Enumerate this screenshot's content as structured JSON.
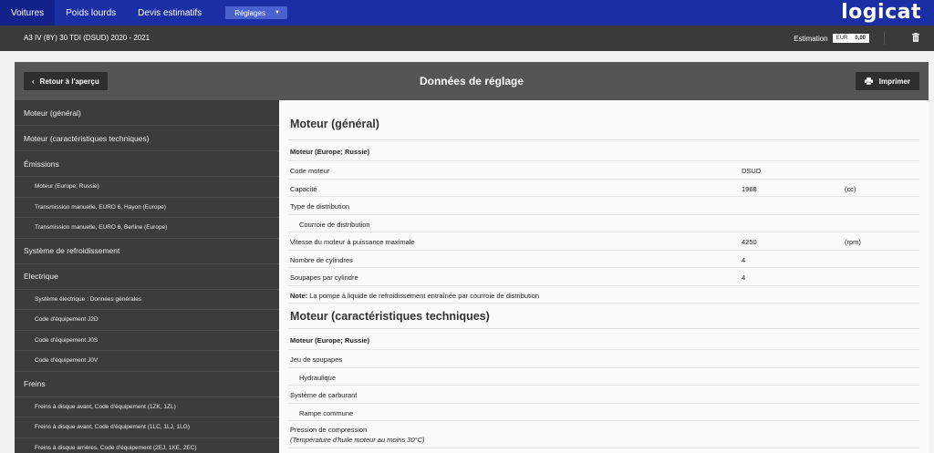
{
  "nav": {
    "tabs": [
      {
        "label": "Voitures"
      },
      {
        "label": "Poids lourds"
      },
      {
        "label": "Devis estimatifs"
      }
    ],
    "dropdown_label": "Réglages",
    "logo": "logicat"
  },
  "vehicle": {
    "name": "A3 IV (8Y) 30 TDI (DSUD) 2020 - 2021",
    "estimation_label": "Estimation",
    "currency": "EUR",
    "amount": "0,00"
  },
  "panel": {
    "back_label": "Retour à l'aperçu",
    "title": "Données de réglage",
    "print_label": "Imprimer"
  },
  "sidebar": {
    "items": [
      {
        "label": "Moteur (général)",
        "level": 1
      },
      {
        "label": "Moteur (caractéristiques techniques)",
        "level": 1
      },
      {
        "label": "Émissions",
        "level": 1
      },
      {
        "label": "Moteur (Europe; Russie)",
        "level": 2
      },
      {
        "label": "Transmission manuelle, EURO 6, Hayon (Europe)",
        "level": 2
      },
      {
        "label": "Transmission manuelle, EURO 6, Berline (Europe)",
        "level": 2
      },
      {
        "label": "Système de refroidissement",
        "level": 1
      },
      {
        "label": "Electrique",
        "level": 1
      },
      {
        "label": "Système électrique : Données générales",
        "level": 2
      },
      {
        "label": "Code d'équipement J2D",
        "level": 2
      },
      {
        "label": "Code d'équipement J0S",
        "level": 2
      },
      {
        "label": "Code d'équipement J0V",
        "level": 2
      },
      {
        "label": "Freins",
        "level": 1
      },
      {
        "label": "Freins à disque avant, Code d'équipement (1ZK, 1ZL)",
        "level": 2
      },
      {
        "label": "Freins à disque avant, Code d'équipement (1LC, 1LJ, 1LG)",
        "level": 2
      },
      {
        "label": "Freins à disque arrières, Code d'équipement (2EJ, 1KE, 2EC)",
        "level": 2
      }
    ]
  },
  "content": {
    "sections": [
      {
        "title": "Moteur (général)",
        "subtitle": "Moteur (Europe; Russie)",
        "rows": [
          {
            "label": "Code moteur",
            "value": "DSUD",
            "unit": ""
          },
          {
            "label": "Capacité",
            "value": "1968",
            "unit": "(cc)"
          },
          {
            "label": "Type de distribution",
            "value": "",
            "unit": ""
          },
          {
            "label": "Courroie de distribution",
            "value": "",
            "unit": "",
            "indent": true
          },
          {
            "label": "Vitesse du moteur à puissance maximale",
            "value": "4250",
            "unit": "(rpm)"
          },
          {
            "label": "Nombre de cylindres",
            "value": "4",
            "unit": ""
          },
          {
            "label": "Soupapes par cylindre",
            "value": "4",
            "unit": ""
          }
        ],
        "note_label": "Note:",
        "note_text": "La pompe à liquide de refroidissement entraînée par courroie de distribution"
      },
      {
        "title": "Moteur (caractéristiques techniques)",
        "subtitle": "Moteur (Europe; Russie)",
        "rows": [
          {
            "label": "Jeu de soupapes",
            "value": "",
            "unit": ""
          },
          {
            "label": "Hydraulique",
            "value": "",
            "unit": "",
            "indent": true
          },
          {
            "label": "Système de carburant",
            "value": "",
            "unit": ""
          },
          {
            "label": "Rampe commune",
            "value": "",
            "unit": "",
            "indent": true
          }
        ],
        "last_label": "Pression de compression",
        "last_sub": "(Température d'huile moteur au moins 30°C)"
      }
    ]
  },
  "colors": {
    "nav_bg": "#1a2fa3",
    "vehicle_bar_bg": "#3a3a3a",
    "sidebar_bg": "#3c3c3c",
    "panel_head_bg": "#555555"
  }
}
